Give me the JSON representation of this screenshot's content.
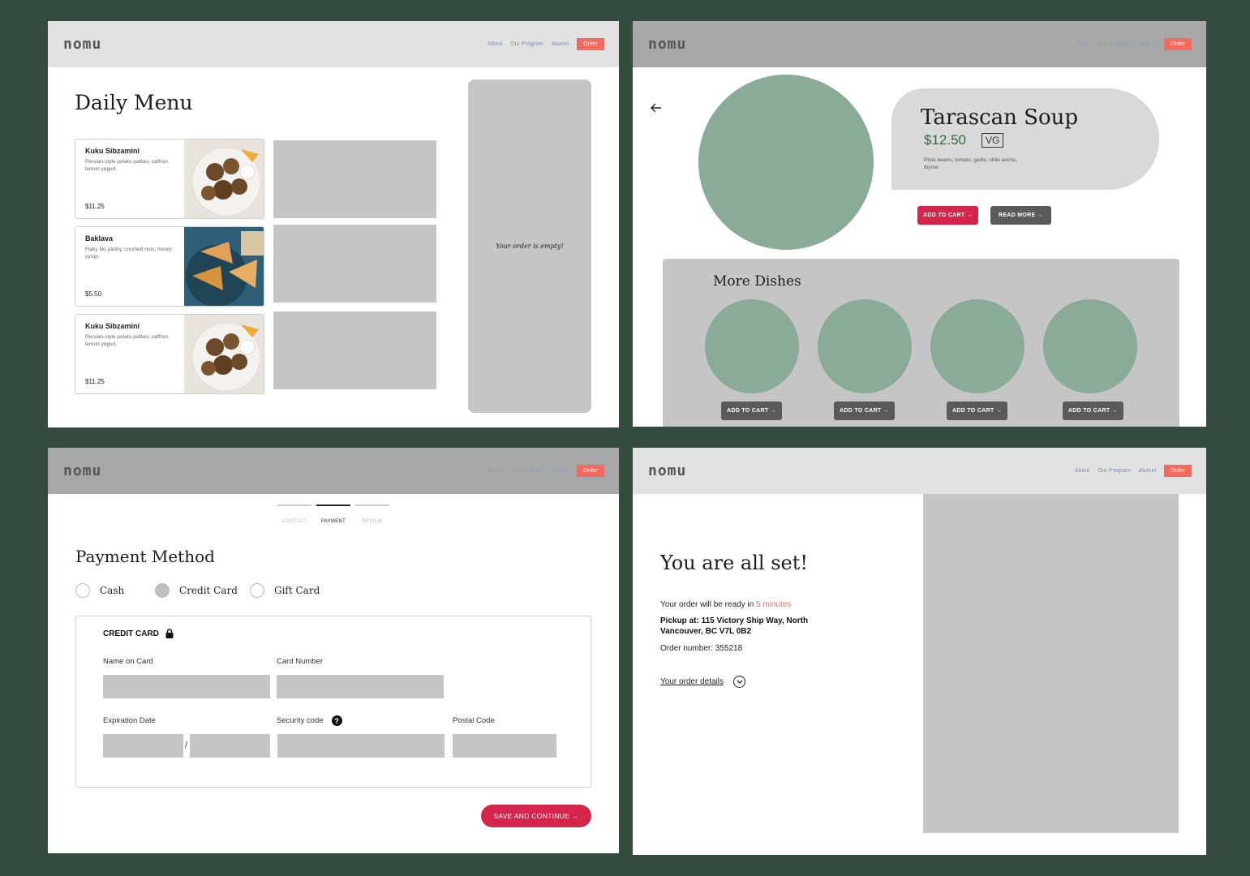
{
  "nav": {
    "logo": "nomu",
    "about": "About",
    "program": "Our Program",
    "alumni": "Alumni",
    "order": "Order"
  },
  "menu": {
    "title": "Daily Menu",
    "dishes": [
      {
        "name": "Kuku Sibzamini",
        "desc": "Persian-style potato patties, saffron, lemon yogurt.",
        "price": "$11.25"
      },
      {
        "name": "Baklava",
        "desc": "Flaky filo pastry, crushed nuts, honey syrup.",
        "price": "$5.50"
      },
      {
        "name": "Kuku Sibzamini",
        "desc": "Persian-style potato patties, saffron, lemon yogurt.",
        "price": "$11.25"
      }
    ],
    "cart_empty": "Your order is empty!"
  },
  "dish": {
    "back_icon": "arrow-left-icon",
    "name": "Tarascan Soup",
    "price": "$12.50",
    "tag": "VG",
    "desc": "Pinto beans, tomato, garlic, chile ancho, thyme",
    "add_to_cart": "ADD TO CART →",
    "read_more": "READ MORE →",
    "more_title": "More Dishes",
    "more_add": "ADD TO CART →"
  },
  "payment": {
    "steps": [
      "CONTACT",
      "PAYMENT",
      "REVIEW"
    ],
    "active_step": "PAYMENT",
    "title": "Payment Method",
    "options": [
      "Cash",
      "Credit Card",
      "Gift Card"
    ],
    "selected": "Credit Card",
    "cc_heading": "CREDIT CARD",
    "name_label": "Name on Card",
    "number_label": "Card Number",
    "exp_label": "Expiration Date",
    "exp_sep": "/",
    "sec_label": "Security code",
    "help_glyph": "?",
    "postal_label": "Postal Code",
    "save": "SAVE AND CONTINUE →"
  },
  "confirm": {
    "title": "You are all set!",
    "ready_prefix": "Your order will be ready in ",
    "ready_time": "5 minutes",
    "pickup": "Pickup at: 115 Victory Ship Way, North Vancouver, BC V7L 0B2",
    "order_number": "Order number: 355218",
    "details": "Your order details",
    "chevron": "⌄"
  },
  "colors": {
    "background": "#344c40",
    "accent_red": "#d6254a",
    "nav_order": "#f26b5e",
    "placeholder_green": "#8aab99"
  }
}
